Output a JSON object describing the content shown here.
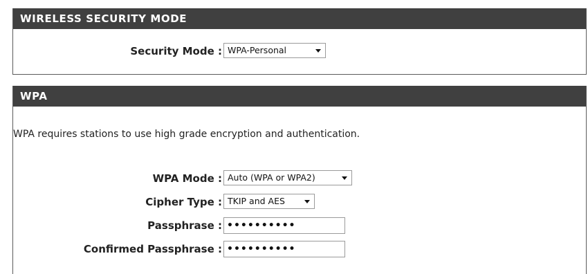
{
  "security_mode_section": {
    "title": "WIRELESS SECURITY MODE",
    "security_mode_label": "Security Mode :",
    "security_mode_value": "WPA-Personal"
  },
  "wpa_section": {
    "title": "WPA",
    "description": "WPA requires stations to use high grade encryption and authentication.",
    "wpa_mode_label": "WPA Mode :",
    "wpa_mode_value": "Auto (WPA or WPA2)",
    "cipher_type_label": "Cipher Type :",
    "cipher_type_value": "TKIP and AES",
    "passphrase_label": "Passphrase :",
    "passphrase_value": "••••••••••",
    "confirmed_passphrase_label": "Confirmed Passphrase :",
    "confirmed_passphrase_value": "••••••••••"
  },
  "colors": {
    "header_bg": "#404040",
    "header_text": "#ffffff",
    "border": "#5a5a5a"
  },
  "icons": {
    "dropdown": "chevron-down-icon"
  }
}
